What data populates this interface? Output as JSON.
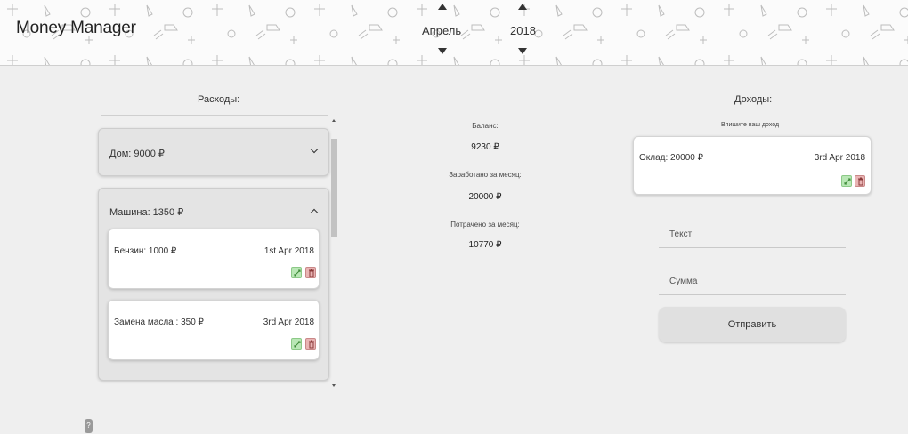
{
  "header": {
    "app_title": "Money Manager",
    "month": "Апрель",
    "year": "2018"
  },
  "expenses": {
    "title": "Расходы:",
    "categories": [
      {
        "label": "Дом: 9000 ₽",
        "expanded": false,
        "entries": []
      },
      {
        "label": "Машина: 1350 ₽",
        "expanded": true,
        "entries": [
          {
            "name": "Бензин: 1000 ₽",
            "date": "1st Apr 2018"
          },
          {
            "name": "Замена масла : 350 ₽",
            "date": "3rd Apr 2018"
          }
        ]
      }
    ]
  },
  "stats": {
    "balance_label": "Баланс:",
    "balance_value": "9230 ₽",
    "earned_label": "Заработано за месяц:",
    "earned_value": "20000 ₽",
    "spent_label": "Потрачено за месяц:",
    "spent_value": "10770 ₽"
  },
  "income": {
    "title": "Доходы:",
    "subtitle": "Впишите ваш доход",
    "entries": [
      {
        "name": "Оклад: 20000 ₽",
        "date": "3rd Apr 2018"
      }
    ],
    "text_placeholder": "Текст",
    "sum_placeholder": "Сумма",
    "submit_label": "Отправить"
  },
  "help": {
    "label": "?"
  },
  "colors": {
    "edit_button": "#b9e7b5",
    "delete_button": "#e9b4b4",
    "page_background": "#efefef"
  }
}
